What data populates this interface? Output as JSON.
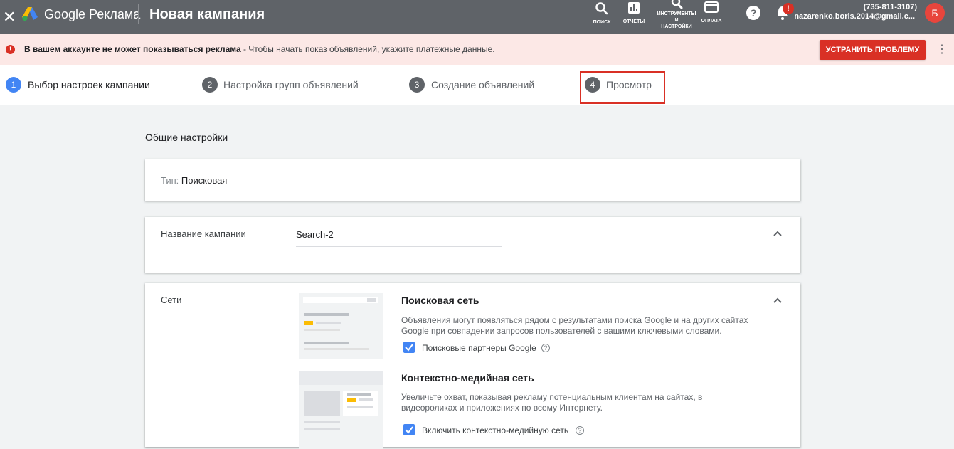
{
  "topbar": {
    "close_icon": "close-icon",
    "brand": "Google Реклама",
    "title": "Новая кампания",
    "tools": [
      {
        "label": "ПОИСК",
        "icon": "search-icon"
      },
      {
        "label": "ОТЧЕТЫ",
        "icon": "reports-icon"
      },
      {
        "label_line1": "ИНСТРУМЕНТЫ",
        "label_line2": "И",
        "label_line3": "НАСТРОЙКИ",
        "icon": "wrench-icon"
      },
      {
        "label": "ОПЛАТА",
        "icon": "credit-card-icon"
      }
    ],
    "notification_badge": "!",
    "account_phone": "(735-811-3107)",
    "account_email": "nazarenko.boris.2014@gmail.c...",
    "avatar_letter": "Б"
  },
  "alert": {
    "bold_text": "В вашем аккаунте не может показываться реклама",
    "text": " - Чтобы начать показ объявлений, укажите платежные данные.",
    "fix_button": "УСТРАНИТЬ ПРОБЛЕМУ",
    "icon_glyph": "!"
  },
  "stepper": {
    "steps": [
      {
        "num": "1",
        "label": "Выбор настроек кампании",
        "active": true
      },
      {
        "num": "2",
        "label": "Настройка групп объявлений",
        "active": false
      },
      {
        "num": "3",
        "label": "Создание объявлений",
        "active": false
      },
      {
        "num": "4",
        "label": "Просмотр",
        "active": false
      }
    ]
  },
  "main": {
    "section_title": "Общие настройки",
    "type_label": "Тип:",
    "type_value": "Поисковая",
    "campaign_name_label": "Название кампании",
    "campaign_name_value": "Search-2",
    "networks_label": "Сети",
    "search_network": {
      "title": "Поисковая сеть",
      "description": "Объявления могут появляться рядом с результатами поиска Google и на других сайтах Google при совпадении запросов пользователей с вашими ключевыми словами.",
      "checkbox_label": "Поисковые партнеры Google",
      "checked": true
    },
    "display_network": {
      "title": "Контекстно-медийная сеть",
      "description": "Увеличьте охват, показывая рекламу потенциальным клиентам на сайтах, в видеороликах и приложениях по всему Интернету.",
      "checkbox_label": "Включить контекстно-медийную сеть",
      "checked": true
    },
    "info_glyph": "?"
  },
  "colors": {
    "topbar": "#5f6368",
    "alert_bg": "#fce8e6",
    "alert_red": "#d93025",
    "active_step": "#4285f4",
    "highlight_border": "#d93025"
  }
}
